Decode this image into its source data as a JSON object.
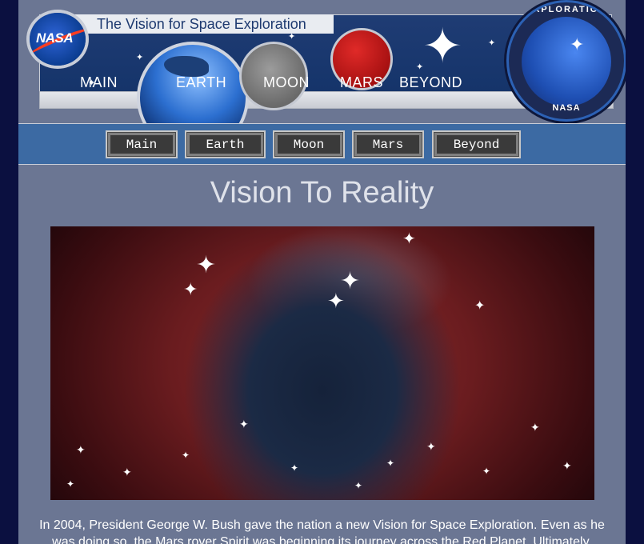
{
  "banner": {
    "title": "The Vision for Space Exploration",
    "words": [
      "MAIN",
      "EARTH",
      "MOON",
      "MARS",
      "BEYOND"
    ],
    "nasa_logo_text": "NASA",
    "patch_top_text": "EXPLORATION",
    "patch_bottom_text": "NASA"
  },
  "nav": {
    "buttons": [
      "Main",
      "Earth",
      "Moon",
      "Mars",
      "Beyond"
    ]
  },
  "main": {
    "title": "Vision To Reality",
    "intro": "In 2004, President George W. Bush gave the nation a new Vision for Space Exploration. Even as he was doing so, the Mars rover Spirit was beginning its journey across the Red Planet. Ultimately,"
  },
  "colors": {
    "page_background": "#0b1040",
    "content_background": "#6b7693",
    "nav_background": "#3c6aa3",
    "nav_button": "#3a3a3a"
  }
}
